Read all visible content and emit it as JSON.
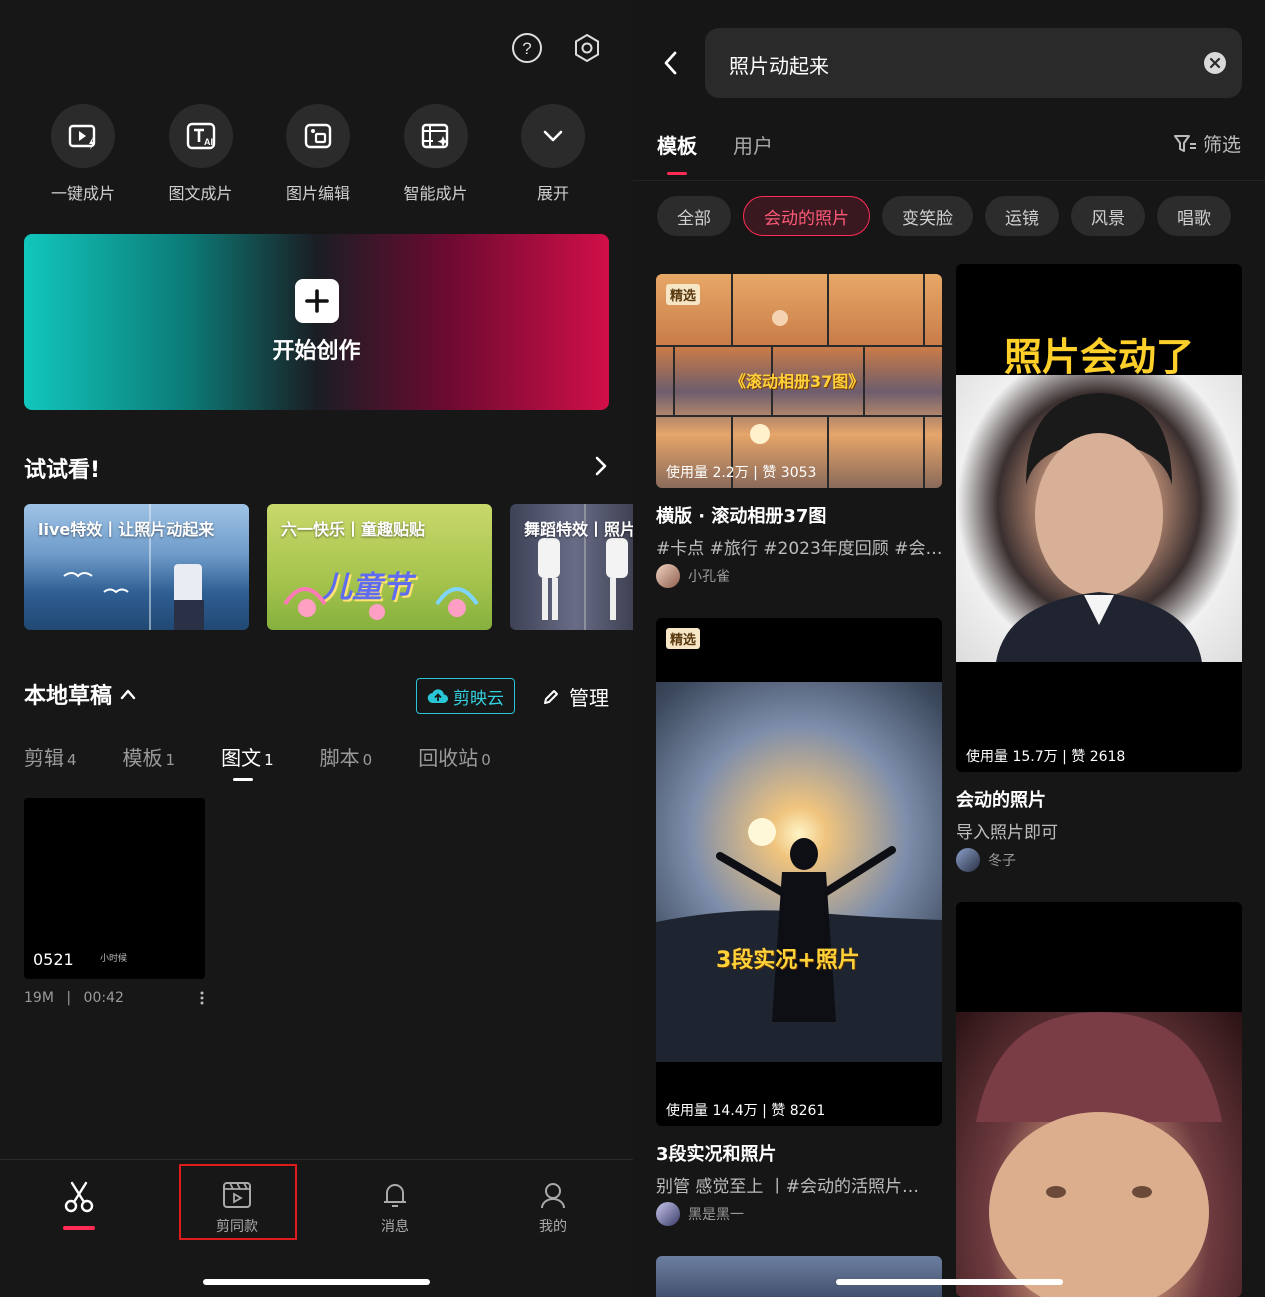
{
  "left": {
    "quick_actions": [
      {
        "label": "一键成片",
        "icon": "one-click-video-icon"
      },
      {
        "label": "图文成片",
        "icon": "text-to-video-icon"
      },
      {
        "label": "图片编辑",
        "icon": "image-edit-icon"
      },
      {
        "label": "智能成片",
        "icon": "smart-video-icon"
      },
      {
        "label": "展开",
        "icon": "chevron-down-icon"
      }
    ],
    "create_label": "开始创作",
    "try_title": "试试看!",
    "try_cards": [
      {
        "caption": "live特效丨让照片动起来"
      },
      {
        "caption": "六一快乐丨童趣贴贴",
        "art_text": "儿童节"
      },
      {
        "caption": "舞蹈特效丨照片"
      }
    ],
    "drafts_title": "本地草稿",
    "cloud_label": "剪映云",
    "manage_label": "管理",
    "draft_tabs": [
      {
        "label": "剪辑",
        "count": "4"
      },
      {
        "label": "模板",
        "count": "1"
      },
      {
        "label": "图文",
        "count": "1"
      },
      {
        "label": "脚本",
        "count": "0"
      },
      {
        "label": "回收站",
        "count": "0"
      }
    ],
    "draft": {
      "name": "0521",
      "subtitle": "小时候",
      "size": "19M",
      "divider": "|",
      "duration": "00:42"
    },
    "nav": [
      {
        "label": "",
        "icon": "scissors-icon"
      },
      {
        "label": "剪同款",
        "icon": "template-clip-icon"
      },
      {
        "label": "消息",
        "icon": "bell-icon"
      },
      {
        "label": "我的",
        "icon": "profile-icon"
      }
    ]
  },
  "right": {
    "search_query": "照片动起来",
    "tabs": [
      "模板",
      "用户"
    ],
    "filter_label": "筛选",
    "chips": [
      "全部",
      "会动的照片",
      "变笑脸",
      "运镜",
      "风景",
      "唱歌"
    ],
    "cards": [
      {
        "badge": "精选",
        "overlay": "《滚动相册37图》",
        "usage": "使用量 2.2万 | 赞 3053",
        "title": "横版 · 滚动相册37图",
        "desc": "#卡点 #旅行 #2023年度回顾 #会…",
        "author": "小孔雀"
      },
      {
        "badge": "精选",
        "overlay": "3段实况+照片",
        "usage": "使用量 14.4万 | 赞 8261",
        "title": "3段实况和照片",
        "desc": "别管 感觉至上 丨#会动的活照片…",
        "author": "黑是黑一"
      },
      {
        "header": "照片会动了",
        "usage": "使用量 15.7万 | 赞 2618",
        "title": "会动的照片",
        "desc": "导入照片即可",
        "author": "冬子"
      }
    ]
  },
  "colors": {
    "accent": "#fe2c55",
    "cloud": "#28c6d6",
    "highlight_box": "#e11b1b"
  }
}
